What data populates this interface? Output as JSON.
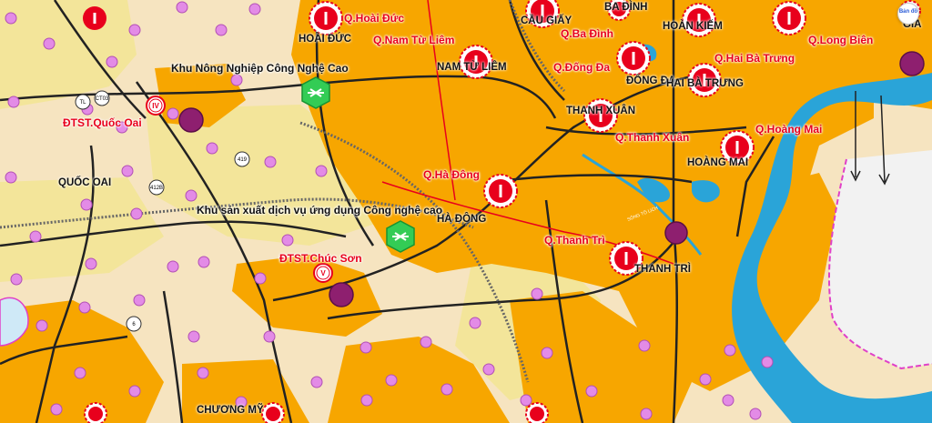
{
  "map": {
    "colors": {
      "urban": "#f7a600",
      "rural": "#f6e4c0",
      "green": "#f3e59a",
      "water": "#2aa4d8",
      "marker_red": "#e8001c",
      "hub_purple": "#8e1f6f",
      "poi_pink": "#e38be6",
      "boundary_magenta": "#e040c8"
    },
    "district_labels": [
      {
        "id": "hoai-duc",
        "text": "Q.Hoài Đức"
      },
      {
        "id": "nam-tu-liem",
        "text": "Q.Nam Từ Liêm"
      },
      {
        "id": "ba-dinh",
        "text": "Q.Ba Đình"
      },
      {
        "id": "dong-da",
        "text": "Q.Đống Đa"
      },
      {
        "id": "hai-ba-trung",
        "text": "Q.Hai Bà Trưng"
      },
      {
        "id": "long-bien",
        "text": "Q.Long Biên"
      },
      {
        "id": "thanh-xuan",
        "text": "Q.Thanh Xuân"
      },
      {
        "id": "hoang-mai",
        "text": "Q.Hoàng Mai"
      },
      {
        "id": "ha-dong",
        "text": "Q.Hà Đông"
      },
      {
        "id": "thanh-tri",
        "text": "Q.Thanh Trì"
      },
      {
        "id": "dtst-quoc-oai",
        "text": "ĐTST.Quốc Oai"
      },
      {
        "id": "dtst-chuc-son",
        "text": "ĐTST.Chúc Sơn"
      }
    ],
    "area_labels": [
      {
        "id": "hoai-duc",
        "text": "HOÀI ĐỨC"
      },
      {
        "id": "cau-giay",
        "text": "CẦU GIẤY"
      },
      {
        "id": "ba-dinh",
        "text": "BA ĐÌNH"
      },
      {
        "id": "hoan-kiem",
        "text": "HOÀN KIẾM"
      },
      {
        "id": "nam-tu-liem",
        "text": "NAM TỪ LIÊM"
      },
      {
        "id": "dong-da",
        "text": "ĐỐNG ĐA"
      },
      {
        "id": "hai-ba-trung",
        "text": "HAI BÀ TRƯNG"
      },
      {
        "id": "thanh-xuan",
        "text": "THANH XUÂN"
      },
      {
        "id": "hoang-mai",
        "text": "HOÀNG MAI"
      },
      {
        "id": "ha-dong",
        "text": "HÀ ĐÔNG"
      },
      {
        "id": "thanh-tri",
        "text": "THANH TRÌ"
      },
      {
        "id": "quoc-oai",
        "text": "QUỐC OAI"
      },
      {
        "id": "chuong-my",
        "text": "CHƯƠNG MỸ"
      },
      {
        "id": "gia",
        "text": "GIA"
      }
    ],
    "zone_labels": [
      {
        "id": "khu-nong-nghiep",
        "text": "Khu Nông Nghiệp Công Nghệ Cao"
      },
      {
        "id": "khu-san-xuat",
        "text": "Khu sản xuất dịch vụ ứng dụng Công nghệ cao"
      }
    ],
    "road_labels": [
      {
        "id": "tl",
        "text": "TL"
      },
      {
        "id": "ct03",
        "text": "CT03"
      },
      {
        "id": "r419",
        "text": "419"
      },
      {
        "id": "r412b",
        "text": "412B"
      },
      {
        "id": "r6",
        "text": "6"
      }
    ],
    "roman_markers": [
      {
        "id": "quoc-oai",
        "text": "IV"
      },
      {
        "id": "chuc-son",
        "text": "V"
      }
    ],
    "river_label": "SÔNG TÔ LỊCH",
    "zoom_control": {
      "icon": "zoom-globe-icon",
      "label": "Bản đồ"
    }
  }
}
